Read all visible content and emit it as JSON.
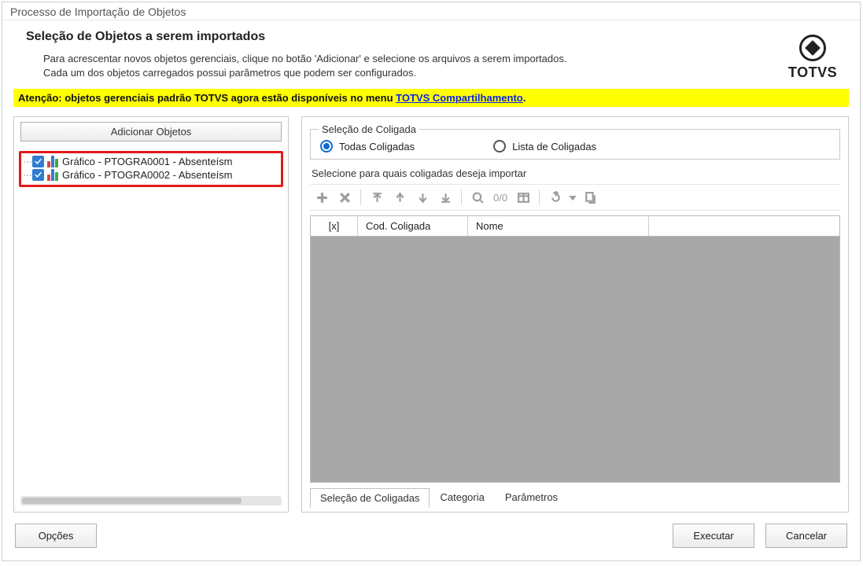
{
  "window_title": "Processo de Importação de Objetos",
  "logo_text": "TOTVS",
  "header": {
    "title": "Seleção de Objetos a serem importados",
    "desc1": "Para acrescentar novos objetos gerenciais, clique no botão 'Adicionar' e selecione os arquivos a serem importados.",
    "desc2": "Cada um dos objetos carregados possui parâmetros que podem ser configurados."
  },
  "notice": {
    "prefix": "Atenção: objetos gerenciais padrão TOTVS agora estão disponíveis no menu ",
    "link": "TOTVS Compartilhamento",
    "suffix": "."
  },
  "left": {
    "add_button": "Adicionar Objetos",
    "items": [
      {
        "label": "Gráfico - PTOGRA0001 - Absenteísm",
        "checked": true
      },
      {
        "label": "Gráfico - PTOGRA0002 - Absenteísm",
        "checked": true
      }
    ]
  },
  "right": {
    "group_legend": "Seleção de Coligada",
    "radio_all": "Todas Coligadas",
    "radio_list": "Lista de Coligadas",
    "sub_label": "Selecione para quais coligadas deseja importar",
    "page_indicator": "0/0",
    "columns": {
      "c0": "[x]",
      "c1": "Cod. Coligada",
      "c2": "Nome"
    },
    "tabs": {
      "t0": "Seleção de Coligadas",
      "t1": "Categoria",
      "t2": "Parâmetros"
    }
  },
  "footer": {
    "options": "Opções",
    "execute": "Executar",
    "cancel": "Cancelar"
  }
}
